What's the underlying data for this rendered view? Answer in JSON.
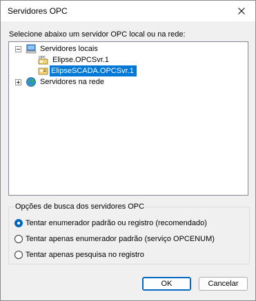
{
  "window": {
    "title": "Servidores OPC",
    "close_icon": "close-icon"
  },
  "prompt": "Selecione abaixo um servidor OPC local ou na rede:",
  "tree": {
    "local_servers": {
      "label": "Servidores locais",
      "expanded": true,
      "icon": "computer-icon"
    },
    "server_1": {
      "label": "Elipse.OPCSvr.1",
      "icon": "opc-server-icon"
    },
    "server_2": {
      "label": "ElipseSCADA.OPCSvr.1",
      "icon": "opc-server-icon",
      "selected": true
    },
    "network_servers": {
      "label": "Servidores na rede",
      "expanded": false,
      "icon": "globe-icon"
    }
  },
  "search_options": {
    "caption": "Opções de busca dos servidores OPC",
    "options": [
      {
        "label": "Tentar enumerador padrão ou registro (recomendado)",
        "checked": true
      },
      {
        "label": "Tentar apenas enumerador padrão (serviço OPCENUM)",
        "checked": false
      },
      {
        "label": "Tentar apenas pesquisa no registro",
        "checked": false
      }
    ]
  },
  "buttons": {
    "ok": "OK",
    "cancel": "Cancelar"
  },
  "colors": {
    "selection": "#0078d7",
    "radio_accent": "#0067c0",
    "default_button_border": "#0067c0"
  }
}
